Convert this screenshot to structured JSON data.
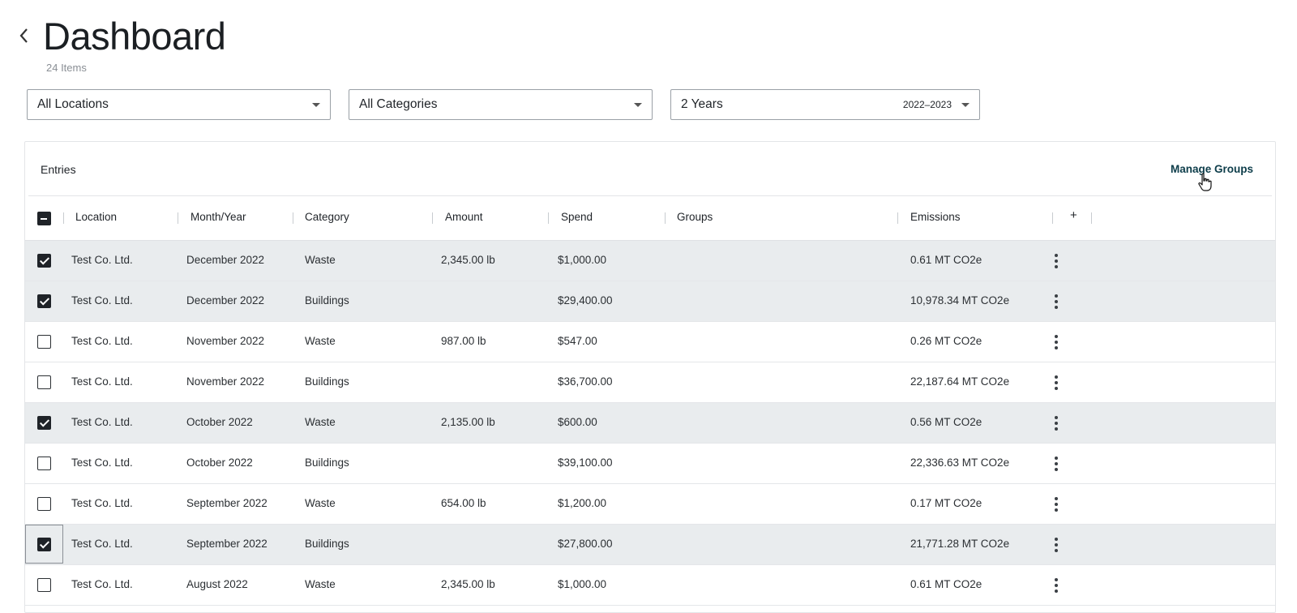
{
  "page": {
    "title": "Dashboard",
    "item_count": "24 Items",
    "back_icon": "chevron-left-icon"
  },
  "filters": {
    "location": {
      "selected": "All Locations"
    },
    "category": {
      "selected": "All Categories"
    },
    "period": {
      "selected": "2 Years",
      "range": "2022–2023"
    }
  },
  "entries": {
    "heading": "Entries",
    "manage_groups_label": "Manage Groups",
    "add_column_label": "+",
    "columns": [
      "Location",
      "Month/Year",
      "Category",
      "Amount",
      "Spend",
      "Groups",
      "Emissions"
    ],
    "select_all_state": "indeterminate",
    "rows": [
      {
        "checked": true,
        "location": "Test Co. Ltd.",
        "month_year": "December 2022",
        "category": "Waste",
        "amount": "2,345.00 lb",
        "spend": "$1,000.00",
        "groups": "",
        "emissions": "0.61 MT CO2e"
      },
      {
        "checked": true,
        "location": "Test Co. Ltd.",
        "month_year": "December 2022",
        "category": "Buildings",
        "amount": "",
        "spend": "$29,400.00",
        "groups": "",
        "emissions": "10,978.34 MT CO2e"
      },
      {
        "checked": false,
        "location": "Test Co. Ltd.",
        "month_year": "November 2022",
        "category": "Waste",
        "amount": "987.00 lb",
        "spend": "$547.00",
        "groups": "",
        "emissions": "0.26 MT CO2e"
      },
      {
        "checked": false,
        "location": "Test Co. Ltd.",
        "month_year": "November 2022",
        "category": "Buildings",
        "amount": "",
        "spend": "$36,700.00",
        "groups": "",
        "emissions": "22,187.64 MT CO2e"
      },
      {
        "checked": true,
        "location": "Test Co. Ltd.",
        "month_year": "October 2022",
        "category": "Waste",
        "amount": "2,135.00 lb",
        "spend": "$600.00",
        "groups": "",
        "emissions": "0.56 MT CO2e"
      },
      {
        "checked": false,
        "location": "Test Co. Ltd.",
        "month_year": "October 2022",
        "category": "Buildings",
        "amount": "",
        "spend": "$39,100.00",
        "groups": "",
        "emissions": "22,336.63 MT CO2e"
      },
      {
        "checked": false,
        "location": "Test Co. Ltd.",
        "month_year": "September 2022",
        "category": "Waste",
        "amount": "654.00 lb",
        "spend": "$1,200.00",
        "groups": "",
        "emissions": "0.17 MT CO2e"
      },
      {
        "checked": true,
        "location": "Test Co. Ltd.",
        "month_year": "September 2022",
        "category": "Buildings",
        "amount": "",
        "spend": "$27,800.00",
        "groups": "",
        "emissions": "21,771.28 MT CO2e"
      },
      {
        "checked": false,
        "location": "Test Co. Ltd.",
        "month_year": "August 2022",
        "category": "Waste",
        "amount": "2,345.00 lb",
        "spend": "$1,000.00",
        "groups": "",
        "emissions": "0.61 MT CO2e"
      }
    ]
  },
  "colors": {
    "selected_row_bg": "#e9ecee",
    "link": "#0d3d4a",
    "checkbox_checked": "#1f2328"
  }
}
